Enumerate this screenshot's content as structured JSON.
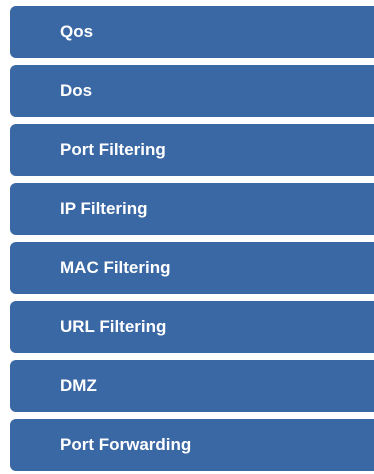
{
  "menu": {
    "items": [
      {
        "label": "Qos"
      },
      {
        "label": "Dos"
      },
      {
        "label": "Port Filtering"
      },
      {
        "label": "IP Filtering"
      },
      {
        "label": "MAC Filtering"
      },
      {
        "label": "URL Filtering"
      },
      {
        "label": "DMZ"
      },
      {
        "label": "Port Forwarding"
      }
    ]
  },
  "colors": {
    "menu_item_background": "#3a68a4",
    "menu_item_text": "#ffffff",
    "page_background": "#ffffff"
  }
}
